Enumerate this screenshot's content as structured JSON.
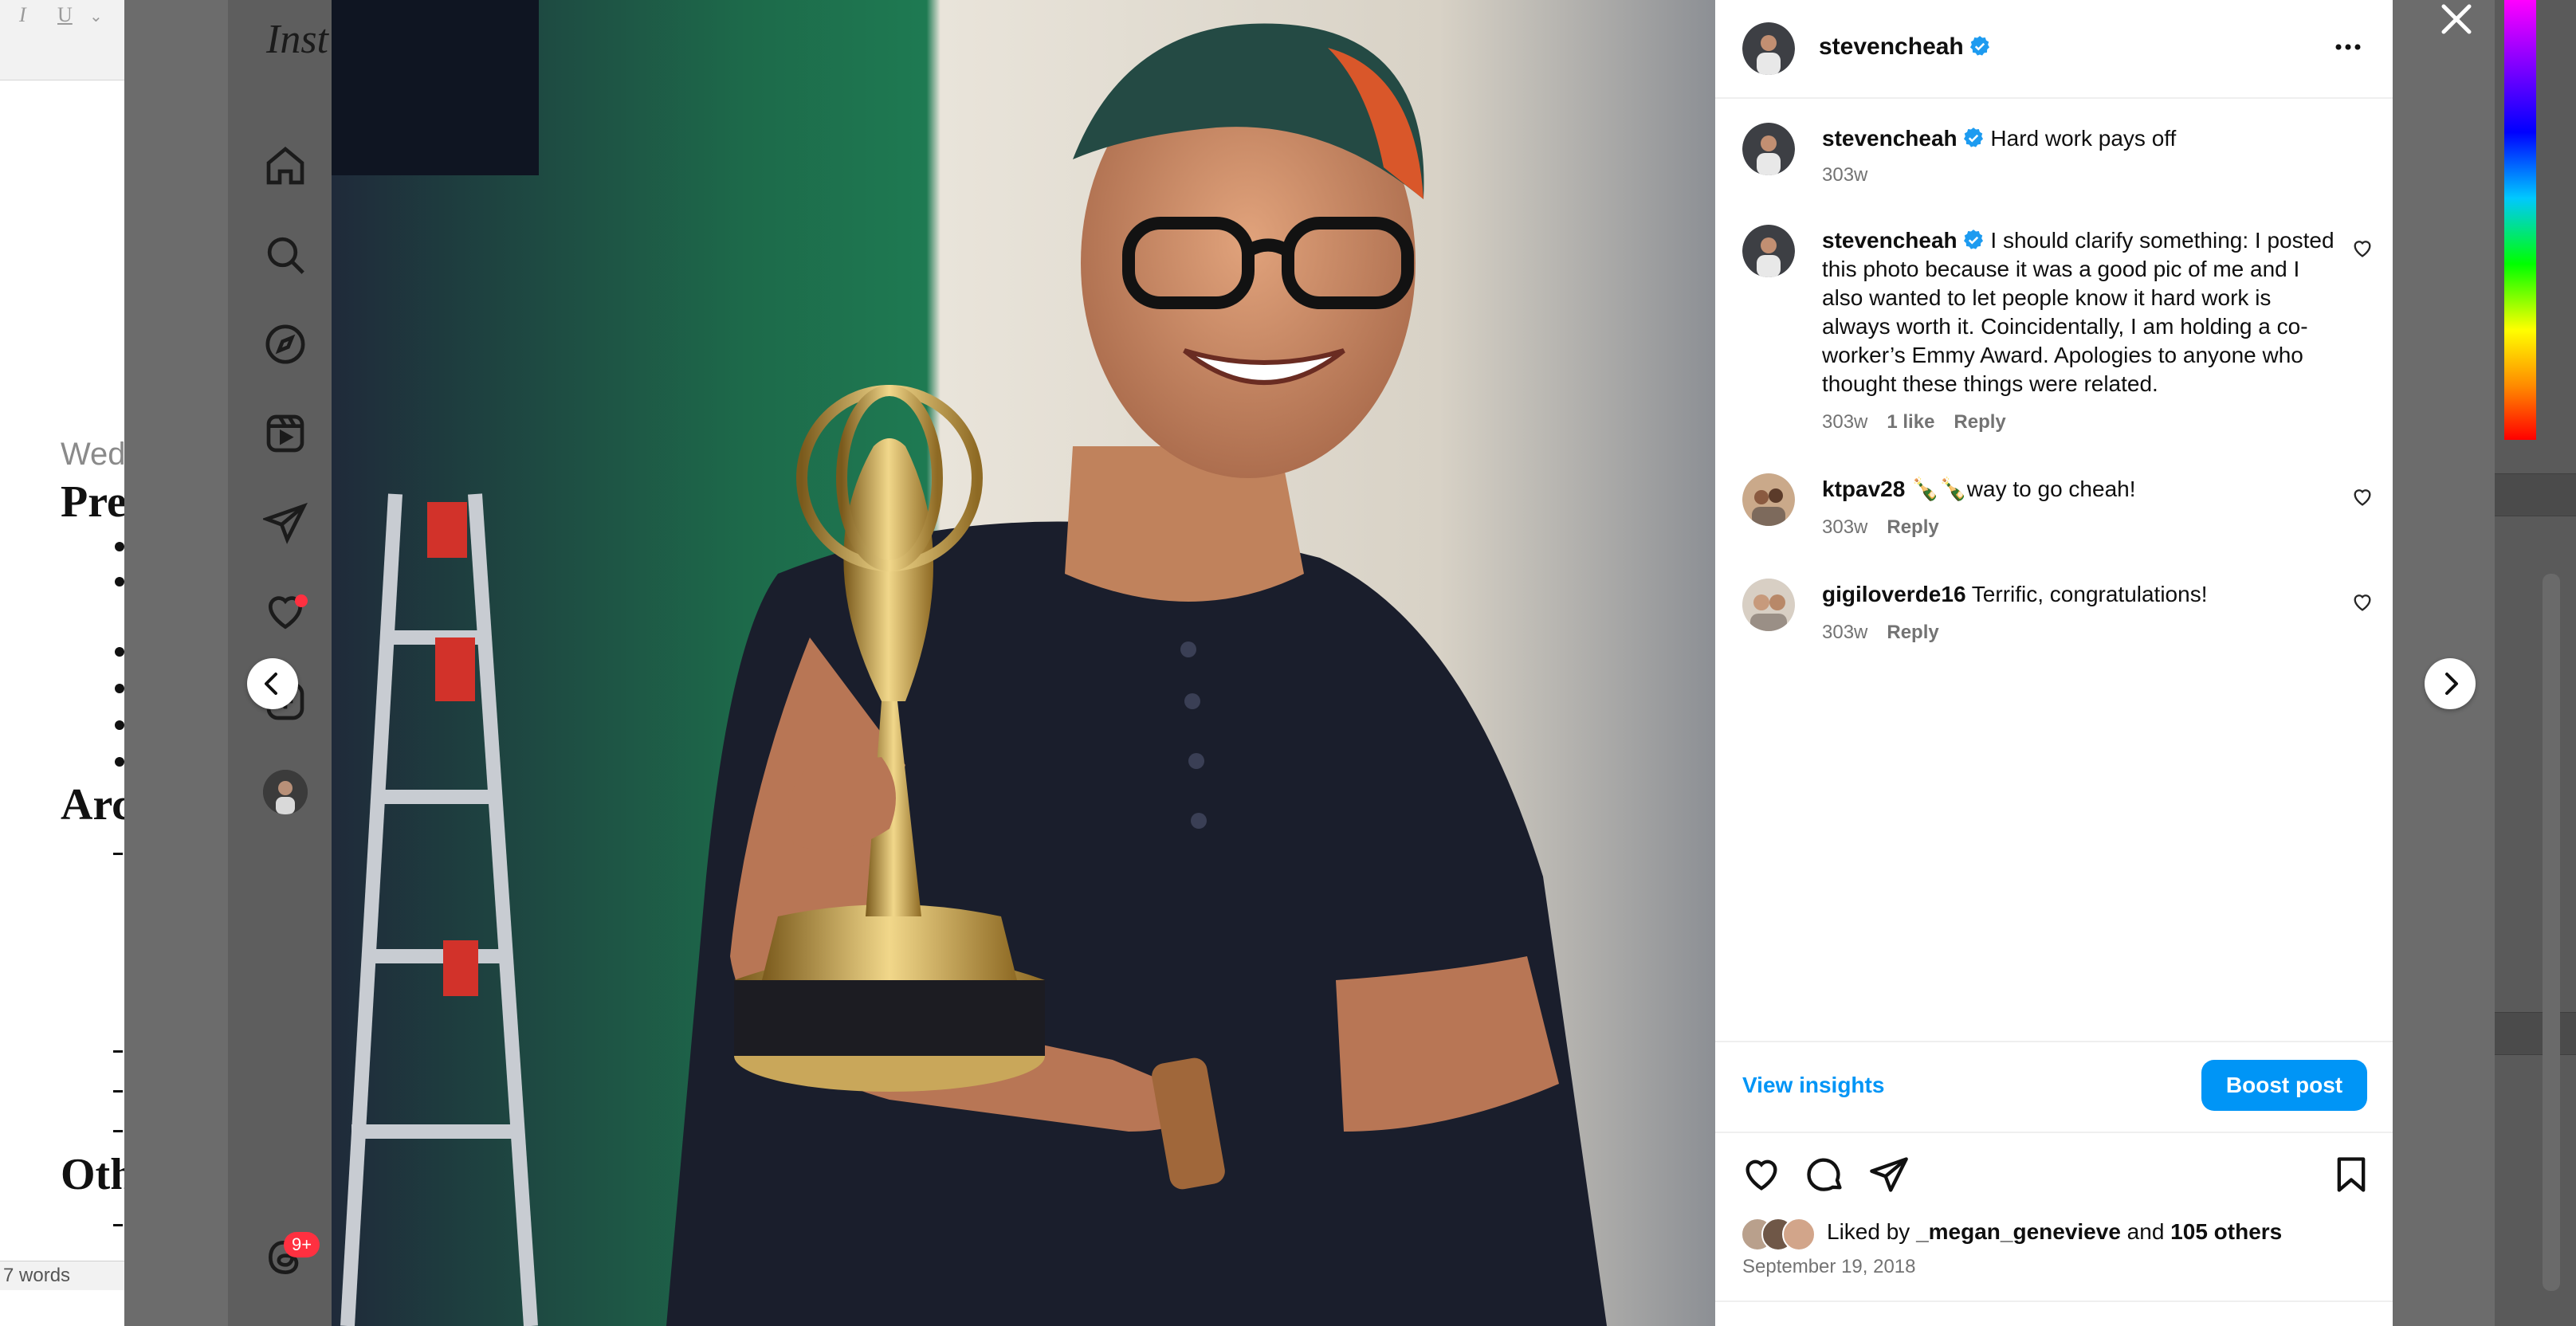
{
  "word_doc": {
    "date_fragment": "Wed",
    "headings": [
      "Pre",
      "Arc",
      "Oth"
    ],
    "status_words": "7 words"
  },
  "instagram": {
    "logo_fragment": "Inst",
    "notifications_badge": "9+",
    "post": {
      "author": "stevencheah",
      "verified": true,
      "caption": "Hard work pays off",
      "caption_age": "303w",
      "comments": [
        {
          "user": "stevencheah",
          "verified": true,
          "text": "I should clarify something: I posted this photo because it was a good pic of me and I also wanted to let people know it hard work is always worth it. Coincidentally, I am holding a co-worker’s Emmy Award. Apologies to anyone who thought these things were related.",
          "age": "303w",
          "likes": "1 like",
          "reply": "Reply"
        },
        {
          "user": "ktpav28",
          "verified": false,
          "text": "🍾🍾way to go cheah!",
          "age": "303w",
          "reply": "Reply"
        },
        {
          "user": "gigiloverde16",
          "verified": false,
          "text": "Terrific, congratulations!",
          "age": "303w",
          "reply": "Reply"
        }
      ],
      "view_insights": "View insights",
      "boost_post": "Boost post",
      "liked_by_prefix": "Liked by",
      "liked_by_user": "_megan_genevieve",
      "liked_by_and": "and",
      "liked_by_others": "105 others",
      "date": "September 19, 2018"
    }
  },
  "colors": {
    "accent_blue": "#0095f6",
    "notification_red": "#ff3040",
    "backdrop": "#6c6c6c"
  },
  "icons": [
    "home-icon",
    "search-icon",
    "explore-icon",
    "reels-icon",
    "messages-icon",
    "notifications-icon",
    "create-icon",
    "threads-icon",
    "close-icon",
    "more-options-icon",
    "chevron-left-icon",
    "chevron-right-icon",
    "heart-icon",
    "comment-icon",
    "share-icon",
    "bookmark-icon",
    "verified-badge-icon"
  ]
}
